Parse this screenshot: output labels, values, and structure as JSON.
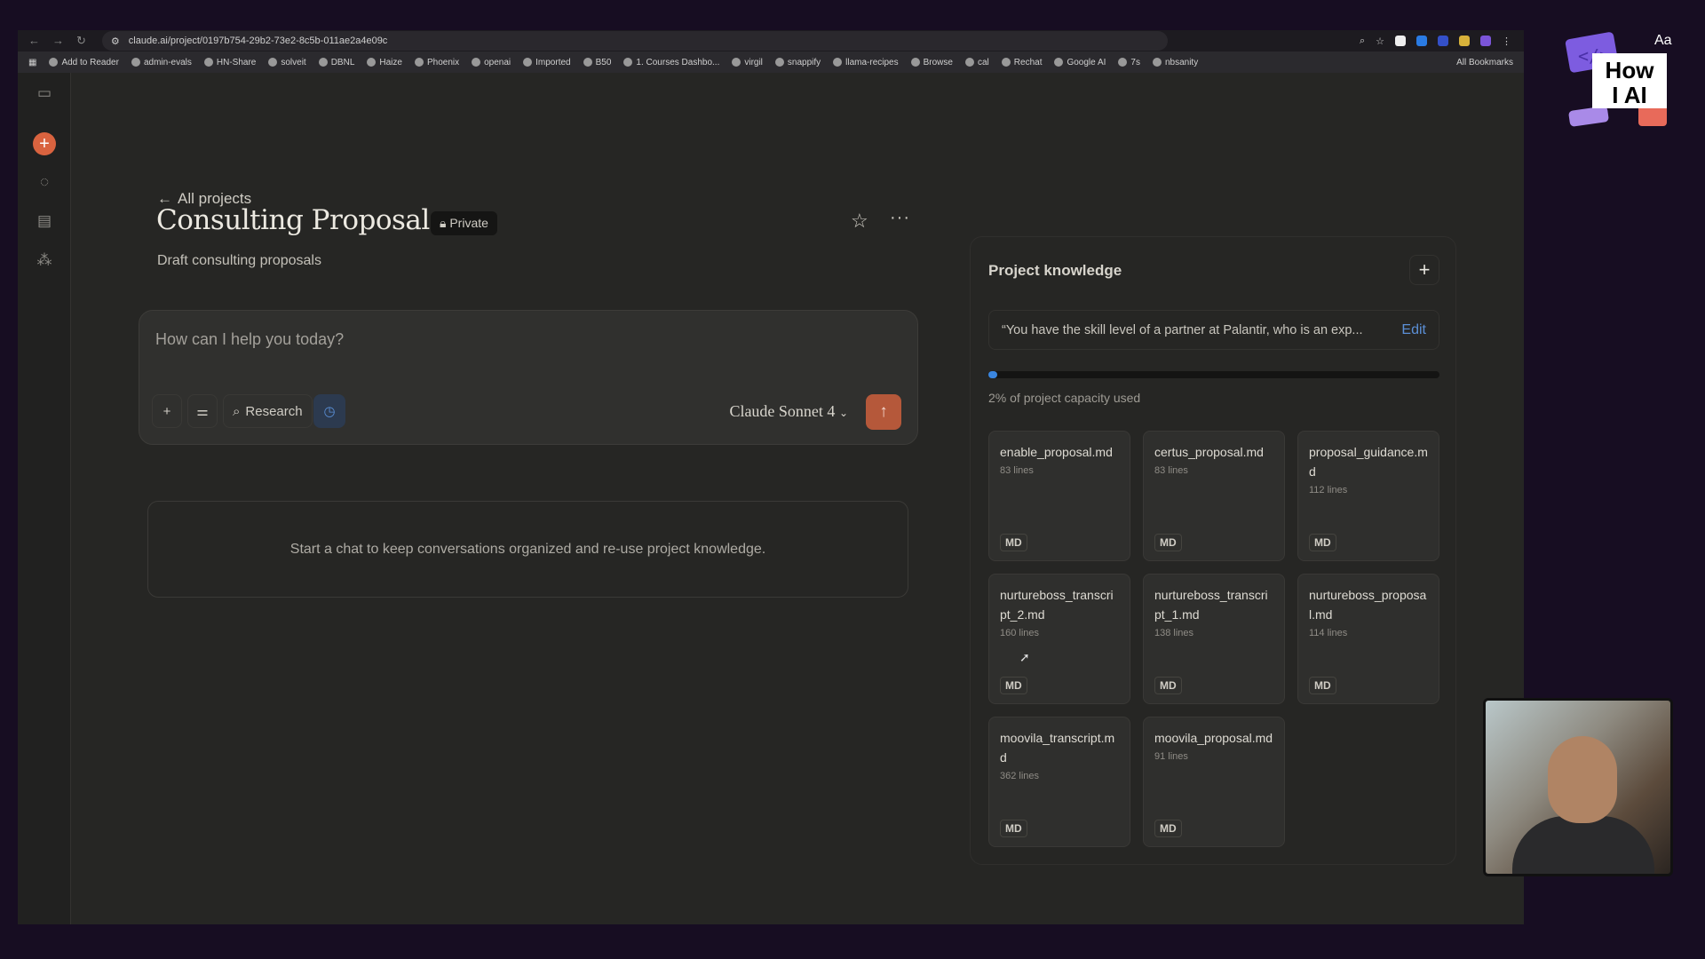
{
  "browser": {
    "url": "claude.ai/project/0197b754-29b2-73e2-8c5b-011ae2a4e09c",
    "bookmarks": [
      "Add to Reader",
      "admin-evals",
      "HN-Share",
      "solveit",
      "DBNL",
      "Haize",
      "Phoenix",
      "openai",
      "Imported",
      "B50",
      "1. Courses Dashbo...",
      "virgil",
      "snappify",
      "llama-recipes",
      "Browse",
      "cal",
      "Rechat",
      "Google AI",
      "7s",
      "nbsanity"
    ],
    "all_bookmarks": "All Bookmarks"
  },
  "project": {
    "back_label": "All projects",
    "title": "Consulting Proposals",
    "visibility": "Private",
    "description": "Draft consulting proposals"
  },
  "composer": {
    "placeholder": "How can I help you today?",
    "research_label": "Research",
    "model": "Claude Sonnet 4"
  },
  "empty_state": "Start a chat to keep conversations organized and re-use project knowledge.",
  "knowledge": {
    "title": "Project knowledge",
    "instructions": "“You have the skill level of a partner at Palantir, who is an exp...",
    "edit_label": "Edit",
    "capacity_percent": 2,
    "capacity_text": "2% of project capacity used",
    "files": [
      {
        "name": "enable_proposal.md",
        "lines": "83 lines",
        "type": "MD"
      },
      {
        "name": "certus_proposal.md",
        "lines": "83 lines",
        "type": "MD"
      },
      {
        "name": "proposal_guidance.md",
        "lines": "112 lines",
        "type": "MD"
      },
      {
        "name": "nurtureboss_transcript_2.md",
        "lines": "160 lines",
        "type": "MD"
      },
      {
        "name": "nurtureboss_transcript_1.md",
        "lines": "138 lines",
        "type": "MD"
      },
      {
        "name": "nurtureboss_proposal.md",
        "lines": "114 lines",
        "type": "MD"
      },
      {
        "name": "moovila_transcript.md",
        "lines": "362 lines",
        "type": "MD"
      },
      {
        "name": "moovila_proposal.md",
        "lines": "91 lines",
        "type": "MD"
      }
    ]
  },
  "overlay": {
    "logo_text": "How I AI",
    "logo_aa": "Aa"
  }
}
